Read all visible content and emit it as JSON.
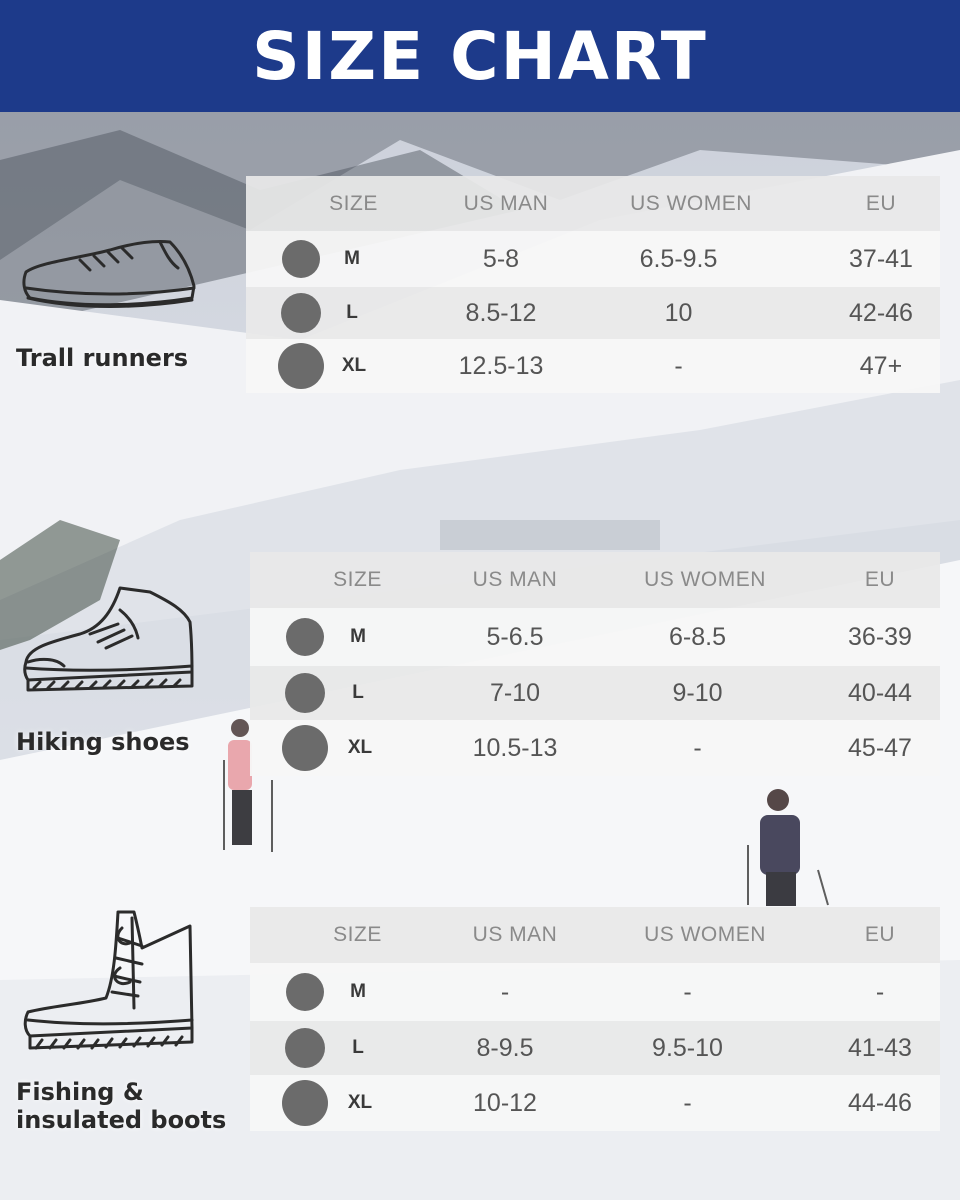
{
  "header": {
    "title": "SIZE CHART"
  },
  "columns": [
    "SIZE",
    "US MAN",
    "US WOMEN",
    "EU"
  ],
  "sections": [
    {
      "label": "Trall runners",
      "icon": "trail-runner-shoe-icon",
      "rows": [
        {
          "size": "M",
          "us_man": "5-8",
          "us_women": "6.5-9.5",
          "eu": "37-41"
        },
        {
          "size": "L",
          "us_man": "8.5-12",
          "us_women": "10",
          "eu": "42-46"
        },
        {
          "size": "XL",
          "us_man": "12.5-13",
          "us_women": "-",
          "eu": "47+"
        }
      ]
    },
    {
      "label": "Hiking shoes",
      "icon": "hiking-shoe-icon",
      "rows": [
        {
          "size": "M",
          "us_man": "5-6.5",
          "us_women": "6-8.5",
          "eu": "36-39"
        },
        {
          "size": "L",
          "us_man": "7-10",
          "us_women": "9-10",
          "eu": "40-44"
        },
        {
          "size": "XL",
          "us_man": "10.5-13",
          "us_women": "-",
          "eu": "45-47"
        }
      ]
    },
    {
      "label": "Fishing &\ninsulated boots",
      "icon": "insulated-boot-icon",
      "rows": [
        {
          "size": "M",
          "us_man": "-",
          "us_women": "-",
          "eu": "-"
        },
        {
          "size": "L",
          "us_man": "8-9.5",
          "us_women": "9.5-10",
          "eu": "41-43"
        },
        {
          "size": "XL",
          "us_man": "10-12",
          "us_women": "-",
          "eu": "44-46"
        }
      ]
    }
  ],
  "colors": {
    "header_bg": "#1d3a8a",
    "dot": "#6b6b6b"
  }
}
